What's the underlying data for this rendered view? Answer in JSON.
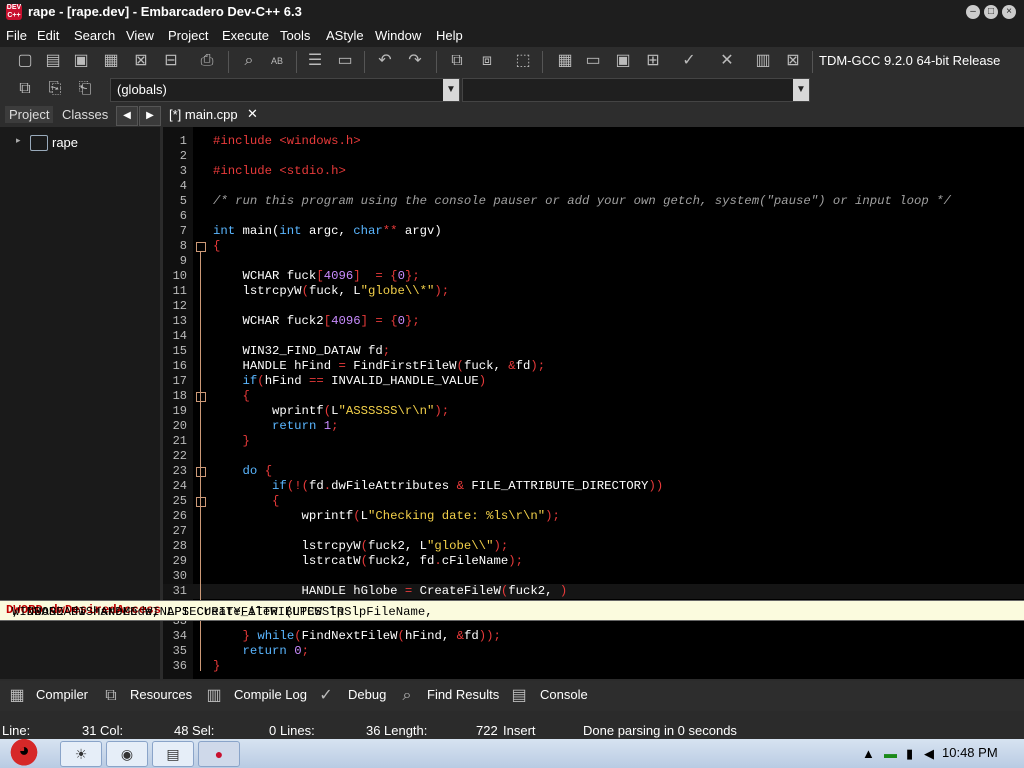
{
  "window": {
    "title": "rape - [rape.dev] - Embarcadero Dev-C++ 6.3",
    "app_icon_text": "DEV C++"
  },
  "menu": [
    "File",
    "Edit",
    "Search",
    "View",
    "Project",
    "Execute",
    "Tools",
    "AStyle",
    "Window",
    "Help"
  ],
  "toolbar": {
    "compiler": "TDM-GCC 9.2.0 64-bit Release",
    "scope_combo": "(globals)",
    "symbol_combo": ""
  },
  "left_panel": {
    "tabs": [
      "Project",
      "Classes"
    ],
    "tree_root": "rape"
  },
  "editor": {
    "tab_label": "[*] main.cpp",
    "lines": [
      {
        "n": "1",
        "html": "<span class='pp'>#include &lt;windows.h&gt;</span>"
      },
      {
        "n": "2",
        "html": ""
      },
      {
        "n": "3",
        "html": "<span class='pp'>#include &lt;stdio.h&gt;</span>"
      },
      {
        "n": "4",
        "html": ""
      },
      {
        "n": "5",
        "html": "<span class='cm'>/* run this program using the console pauser or add your own getch, system(\"pause\") or input loop */</span>"
      },
      {
        "n": "6",
        "html": ""
      },
      {
        "n": "7",
        "html": "<span class='kw'>int</span> main(<span class='kw'>int</span> argc, <span class='kw'>char</span><span class='sym'>**</span> argv)"
      },
      {
        "n": "8",
        "html": "<span class='sym'>{</span>"
      },
      {
        "n": "9",
        "html": ""
      },
      {
        "n": "10",
        "html": "    WCHAR fuck<span class='sym'>[</span><span class='num'>4096</span><span class='sym'>]</span>  <span class='sym'>=</span> <span class='sym'>{</span><span class='num'>0</span><span class='sym'>};</span>"
      },
      {
        "n": "11",
        "html": "    lstrcpyW<span class='sym'>(</span>fuck, L<span class='str'>\"globe\\\\*\"</span><span class='sym'>);</span>"
      },
      {
        "n": "12",
        "html": ""
      },
      {
        "n": "13",
        "html": "    WCHAR fuck2<span class='sym'>[</span><span class='num'>4096</span><span class='sym'>]</span> <span class='sym'>=</span> <span class='sym'>{</span><span class='num'>0</span><span class='sym'>};</span>"
      },
      {
        "n": "14",
        "html": ""
      },
      {
        "n": "15",
        "html": "    WIN32_FIND_DATAW fd<span class='sym'>;</span>"
      },
      {
        "n": "16",
        "html": "    HANDLE hFind <span class='sym'>=</span> FindFirstFileW<span class='sym'>(</span>fuck, <span class='sym'>&amp;</span>fd<span class='sym'>);</span>"
      },
      {
        "n": "17",
        "html": "    <span class='kw'>if</span><span class='sym'>(</span>hFind <span class='sym'>==</span> INVALID_HANDLE_VALUE<span class='sym'>)</span>"
      },
      {
        "n": "18",
        "html": "    <span class='sym'>{</span>"
      },
      {
        "n": "19",
        "html": "        wprintf<span class='sym'>(</span>L<span class='str'>\"ASSSSSS\\r\\n\"</span><span class='sym'>);</span>"
      },
      {
        "n": "20",
        "html": "        <span class='kw'>return</span> <span class='num'>1</span><span class='sym'>;</span>"
      },
      {
        "n": "21",
        "html": "    <span class='sym'>}</span>"
      },
      {
        "n": "22",
        "html": ""
      },
      {
        "n": "23",
        "html": "    <span class='kw'>do</span> <span class='sym'>{</span>"
      },
      {
        "n": "24",
        "html": "        <span class='kw'>if</span><span class='sym'>(!(</span>fd<span class='sym'>.</span>dwFileAttributes <span class='sym'>&amp;</span> FILE_ATTRIBUTE_DIRECTORY<span class='sym'>))</span>"
      },
      {
        "n": "25",
        "html": "        <span class='sym'>{</span>"
      },
      {
        "n": "26",
        "html": "            wprintf<span class='sym'>(</span>L<span class='str'>\"Checking date: %ls\\r\\n\"</span><span class='sym'>);</span>"
      },
      {
        "n": "27",
        "html": ""
      },
      {
        "n": "28",
        "html": "            lstrcpyW<span class='sym'>(</span>fuck2, L<span class='str'>\"globe\\\\\"</span><span class='sym'>);</span>"
      },
      {
        "n": "29",
        "html": "            lstrcatW<span class='sym'>(</span>fuck2, fd<span class='sym'>.</span>cFileName<span class='sym'>);</span>"
      },
      {
        "n": "30",
        "html": ""
      },
      {
        "n": "31",
        "html": "            HANDLE hGlobe <span class='sym'>=</span> CreateFileW<span class='sym'>(</span>fuck2, <span class='sym'>)</span>"
      },
      {
        "n": "32",
        "html": ""
      },
      {
        "n": "33",
        "html": ""
      },
      {
        "n": "34",
        "html": "    <span class='sym'>}</span> <span class='kw'>while</span><span class='sym'>(</span>FindNextFileW<span class='sym'>(</span>hFind, <span class='sym'>&amp;</span>fd<span class='sym'>));</span>"
      },
      {
        "n": "35",
        "html": "    <span class='kw'>return</span> <span class='num'>0</span><span class='sym'>;</span>"
      },
      {
        "n": "36",
        "html": "<span class='sym'>}</span>"
      }
    ],
    "hint": {
      "prefix": "WINBASEAPI HANDLE WINAPI CreateFileW (LPCWSTR lpFileName, ",
      "bold": "DWORD dwDesiredAccess",
      "suffix": ", DWORD dwShareMode, LPSECURITY_ATTRIBUTES lpS"
    }
  },
  "bottom_tabs": [
    "Compiler",
    "Resources",
    "Compile Log",
    "Debug",
    "Find Results",
    "Console"
  ],
  "status": {
    "line_label": "Line:",
    "line_value": "31",
    "col_label": "Col:",
    "col_value": "48",
    "sel_label": "Sel:",
    "sel_value": "0",
    "lines_label": "Lines:",
    "lines_value": "36",
    "length_label": "Length:",
    "length_value": "722",
    "mode": "Insert",
    "message": "Done parsing in 0 seconds"
  },
  "taskbar": {
    "clock": "10:48 PM"
  }
}
